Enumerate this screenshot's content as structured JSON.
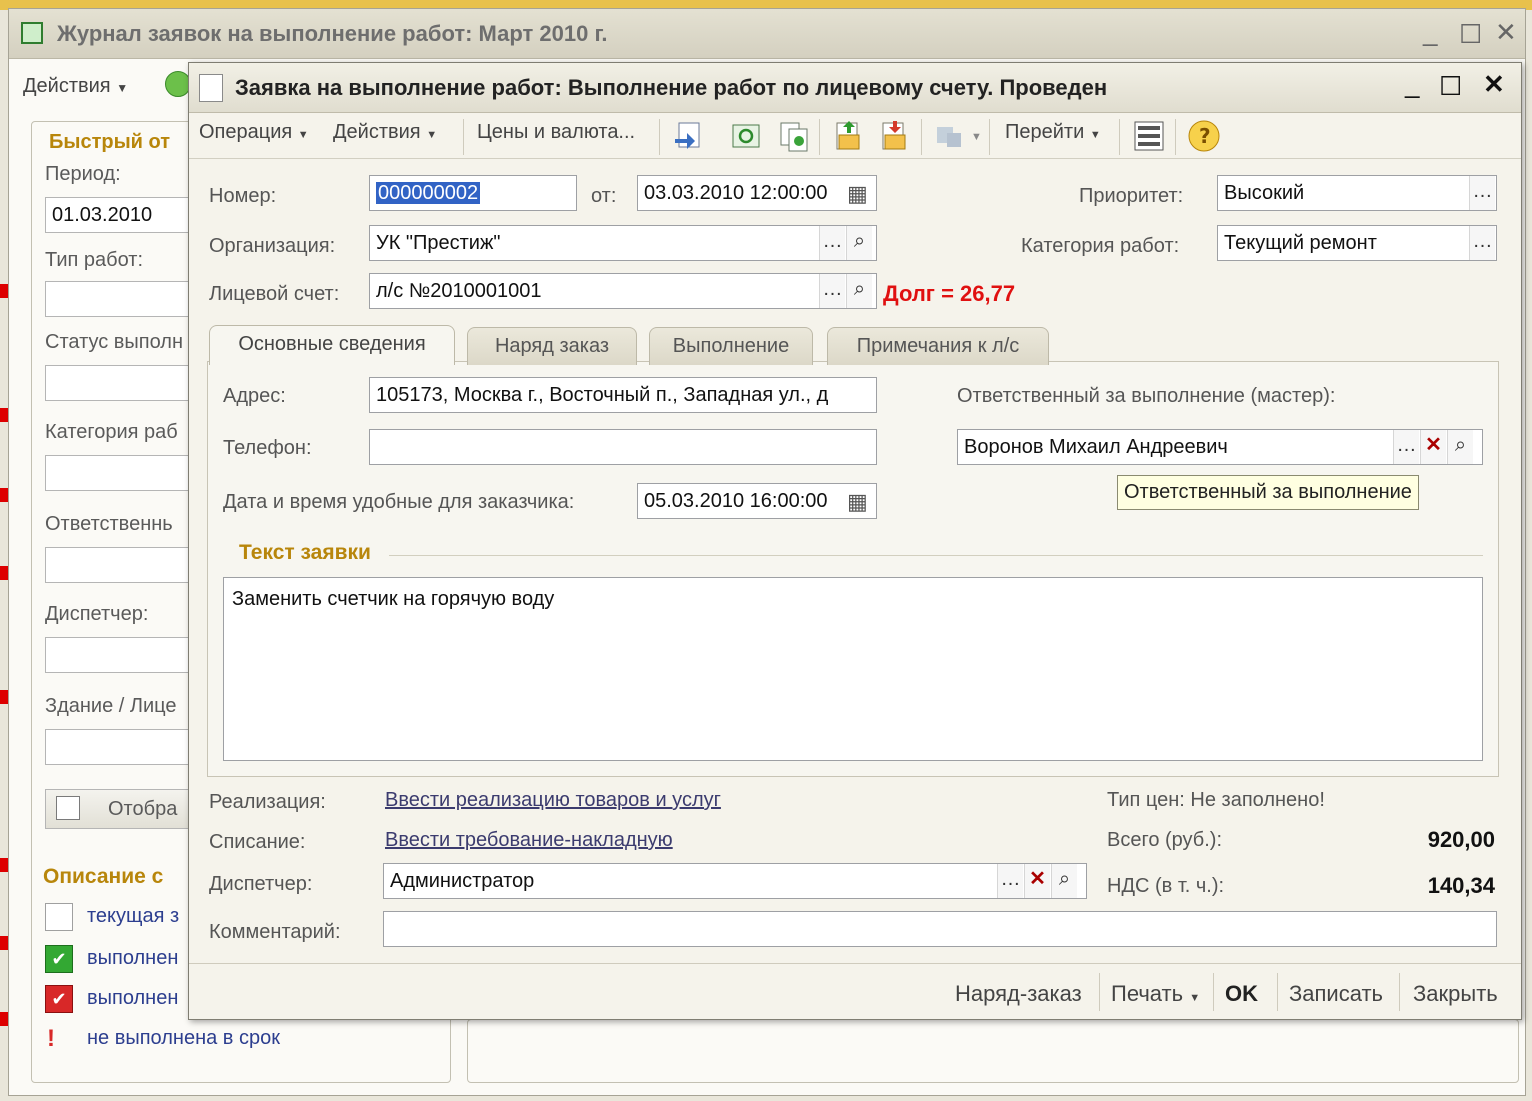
{
  "outer_window": {
    "title": "Журнал заявок на выполнение работ: Март 2010 г.",
    "actions_label": "Действия",
    "quick_filter_title": "Быстрый от",
    "period_label": "Период:",
    "period_value": "01.03.2010",
    "work_type_label": "Тип работ:",
    "status_label": "Статус выполн",
    "category_label": "Категория раб",
    "responsible_label": "Ответственнь",
    "dispatcher_label": "Диспетчер:",
    "building_label": "Здание / Лице",
    "show_button_label": "Отобра",
    "legend_title": "Описание с",
    "legend_items": [
      {
        "label": "текущая з",
        "icon": "empty-checkbox-icon"
      },
      {
        "label": "выполнен",
        "icon": "green-check-icon"
      },
      {
        "label": "выполнен",
        "icon": "red-check-icon"
      },
      {
        "label": "не выполнена в срок",
        "icon": "alert-icon"
      }
    ]
  },
  "dialog": {
    "title": "Заявка на выполнение работ: Выполнение работ по лицевому счету. Проведен",
    "toolbar": {
      "operation": "Операция",
      "actions": "Действия",
      "prices": "Цены и валюта...",
      "goto": "Перейти"
    },
    "header": {
      "number_label": "Номер:",
      "number_value": "000000002",
      "from_label": "от:",
      "date_value": "03.03.2010 12:00:00",
      "priority_label": "Приоритет:",
      "priority_value": "Высокий",
      "org_label": "Организация:",
      "org_value": "УК \"Престиж\"",
      "category_label": "Категория работ:",
      "category_value": "Текущий ремонт",
      "account_label": "Лицевой счет:",
      "account_value": "л/с №2010001001",
      "debt_text": "Долг = 26,77"
    },
    "tabs": [
      "Основные сведения",
      "Наряд заказ",
      "Выполнение",
      "Примечания к л/с"
    ],
    "main": {
      "address_label": "Адрес:",
      "address_value": "105173, Москва г., Восточный п., Западная ул., д",
      "phone_label": "Телефон:",
      "phone_value": "",
      "convenient_label": "Дата и время удобные для заказчика:",
      "convenient_value": "05.03.2010 16:00:00",
      "responsible_label": "Ответственный за выполнение (мастер):",
      "responsible_value": "Воронов Михаил Андреевич",
      "tooltip": "Ответственный за выполнение",
      "request_text_title": "Текст заявки",
      "request_text": "Заменить счетчик на горячую воду"
    },
    "footer": {
      "realization_label": "Реализация:",
      "realization_link": "Ввести реализацию товаров и услуг",
      "writeoff_label": "Списание:",
      "writeoff_link": "Ввести требование-накладную",
      "dispatcher_label": "Диспетчер:",
      "dispatcher_value": "Администратор",
      "comment_label": "Комментарий:",
      "comment_value": "",
      "price_type": "Тип цен: Не заполнено!",
      "total_label": "Всего (руб.):",
      "total_value": "920,00",
      "vat_label": "НДС (в т. ч.):",
      "vat_value": "140,34"
    },
    "buttons": {
      "order": "Наряд-заказ",
      "print": "Печать",
      "ok": "OK",
      "save": "Записать",
      "close": "Закрыть"
    }
  },
  "colors": {
    "accent_gold": "#b8860b",
    "debt_red": "#e01010",
    "selection_blue": "#3163c5"
  }
}
